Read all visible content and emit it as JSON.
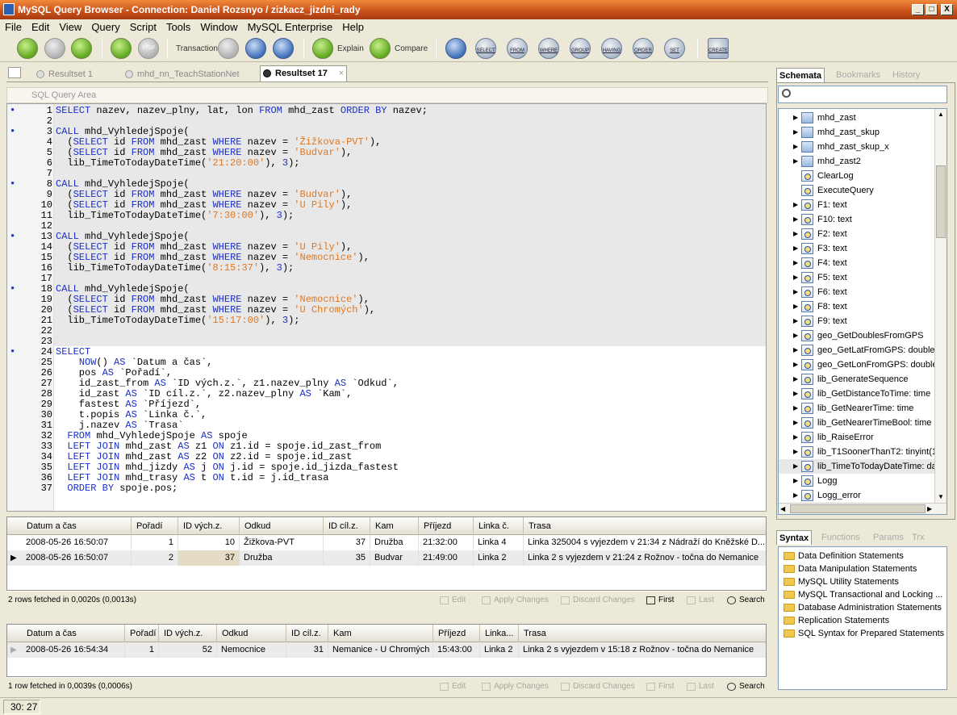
{
  "window": {
    "title": "MySQL Query Browser - Connection: Daniel Rozsnyo / zizkacz_jizdni_rady",
    "buttons": {
      "minimize": "_",
      "maximize": "□",
      "close": "X"
    }
  },
  "menu": [
    "File",
    "Edit",
    "View",
    "Query",
    "Script",
    "Tools",
    "Window",
    "MySQL Enterprise",
    "Help"
  ],
  "toolbar": {
    "transaction_label": "Transaction",
    "explain_label": "Explain",
    "compare_label": "Compare",
    "stop_label": "STOP",
    "clause_buttons": [
      "SELECT",
      "FROM",
      "WHERE",
      "GROUP",
      "HAVING",
      "ORDER",
      "SET"
    ],
    "create_label": "CREATE"
  },
  "tabs": [
    {
      "label": "Resultset 1",
      "active": false
    },
    {
      "label": "mhd_nn_TeachStationNet",
      "active": false
    },
    {
      "label": "Resultset 17",
      "active": true
    }
  ],
  "tab_close": "×",
  "sql_area_label": "SQL Query Area",
  "editor": {
    "lines": [
      {
        "n": "1",
        "b": true,
        "t": "SELECT nazev, nazev_plny, lat, lon FROM mhd_zast ORDER BY nazev;"
      },
      {
        "n": "2",
        "b": false,
        "t": ""
      },
      {
        "n": "3",
        "b": true,
        "t": "CALL mhd_VyhledejSpoje("
      },
      {
        "n": "4",
        "b": false,
        "t": "  (SELECT id FROM mhd_zast WHERE nazev = 'Žižkova-PVT'),"
      },
      {
        "n": "5",
        "b": false,
        "t": "  (SELECT id FROM mhd_zast WHERE nazev = 'Budvar'),"
      },
      {
        "n": "6",
        "b": false,
        "t": "  lib_TimeToTodayDateTime('21:20:00'), 3);"
      },
      {
        "n": "7",
        "b": false,
        "t": ""
      },
      {
        "n": "8",
        "b": true,
        "t": "CALL mhd_VyhledejSpoje("
      },
      {
        "n": "9",
        "b": false,
        "t": "  (SELECT id FROM mhd_zast WHERE nazev = 'Budvar'),"
      },
      {
        "n": "10",
        "b": false,
        "t": "  (SELECT id FROM mhd_zast WHERE nazev = 'U Pily'),"
      },
      {
        "n": "11",
        "b": false,
        "t": "  lib_TimeToTodayDateTime('7:30:00'), 3);"
      },
      {
        "n": "12",
        "b": false,
        "t": ""
      },
      {
        "n": "13",
        "b": true,
        "t": "CALL mhd_VyhledejSpoje("
      },
      {
        "n": "14",
        "b": false,
        "t": "  (SELECT id FROM mhd_zast WHERE nazev = 'U Pily'),"
      },
      {
        "n": "15",
        "b": false,
        "t": "  (SELECT id FROM mhd_zast WHERE nazev = 'Nemocnice'),"
      },
      {
        "n": "16",
        "b": false,
        "t": "  lib_TimeToTodayDateTime('8:15:37'), 3);"
      },
      {
        "n": "17",
        "b": false,
        "t": ""
      },
      {
        "n": "18",
        "b": true,
        "t": "CALL mhd_VyhledejSpoje("
      },
      {
        "n": "19",
        "b": false,
        "t": "  (SELECT id FROM mhd_zast WHERE nazev = 'Nemocnice'),"
      },
      {
        "n": "20",
        "b": false,
        "t": "  (SELECT id FROM mhd_zast WHERE nazev = 'U Chromých'),"
      },
      {
        "n": "21",
        "b": false,
        "t": "  lib_TimeToTodayDateTime('15:17:00'), 3);"
      },
      {
        "n": "22",
        "b": false,
        "t": ""
      },
      {
        "n": "23",
        "b": false,
        "t": ""
      },
      {
        "n": "24",
        "b": true,
        "t": "SELECT"
      },
      {
        "n": "25",
        "b": false,
        "t": "    NOW() AS `Datum a čas`,"
      },
      {
        "n": "26",
        "b": false,
        "t": "    pos AS `Pořadí`,"
      },
      {
        "n": "27",
        "b": false,
        "t": "    id_zast_from AS `ID vých.z.`, z1.nazev_plny AS `Odkud`,"
      },
      {
        "n": "28",
        "b": false,
        "t": "    id_zast AS `ID cíl.z.`, z2.nazev_plny AS `Kam`,"
      },
      {
        "n": "29",
        "b": false,
        "t": "    fastest AS `Příjezd`,"
      },
      {
        "n": "30",
        "b": false,
        "t": "    t.popis AS `Linka č.`,"
      },
      {
        "n": "31",
        "b": false,
        "t": "    j.nazev AS `Trasa`"
      },
      {
        "n": "32",
        "b": false,
        "t": "  FROM mhd_VyhledejSpoje AS spoje"
      },
      {
        "n": "33",
        "b": false,
        "t": "  LEFT JOIN mhd_zast AS z1 ON z1.id = spoje.id_zast_from"
      },
      {
        "n": "34",
        "b": false,
        "t": "  LEFT JOIN mhd_zast AS z2 ON z2.id = spoje.id_zast"
      },
      {
        "n": "35",
        "b": false,
        "t": "  LEFT JOIN mhd_jizdy AS j ON j.id = spoje.id_jizda_fastest"
      },
      {
        "n": "36",
        "b": false,
        "t": "  LEFT JOIN mhd_trasy AS t ON t.id = j.id_trasa"
      },
      {
        "n": "37",
        "b": false,
        "t": "  ORDER BY spoje.pos;"
      }
    ]
  },
  "result1": {
    "columns": [
      "Datum a čas",
      "Pořadí",
      "ID vých.z.",
      "Odkud",
      "ID cíl.z.",
      "Kam",
      "Příjezd",
      "Linka č.",
      "Trasa"
    ],
    "rows": [
      [
        "2008-05-26 16:50:07",
        "1",
        "10",
        "Žižkova-PVT",
        "37",
        "Družba",
        "21:32:00",
        "Linka 4",
        "Linka 325004 s vyjezdem v 21:34 z Nádraží do Kněžské D..."
      ],
      [
        "2008-05-26 16:50:07",
        "2",
        "37",
        "Družba",
        "35",
        "Budvar",
        "21:49:00",
        "Linka 2",
        "Linka 2 s vyjezdem v 21:24 z Rožnov - točna do Nemanice"
      ]
    ],
    "status": "2 rows fetched in 0,0020s (0,0013s)"
  },
  "result2": {
    "columns": [
      "Datum a čas",
      "Pořadí",
      "ID vých.z.",
      "Odkud",
      "ID cíl.z.",
      "Kam",
      "Příjezd",
      "Linka...",
      "Trasa"
    ],
    "rows": [
      [
        "2008-05-26 16:54:34",
        "1",
        "52",
        "Nemocnice",
        "31",
        "Nemanice - U Chromých",
        "15:43:00",
        "Linka 2",
        "Linka 2 s vyjezdem v 15:18 z Rožnov - točna do Nemanice"
      ]
    ],
    "status": "1 row fetched in 0,0039s (0,0006s)"
  },
  "result_actions": [
    "Edit",
    "Apply Changes",
    "Discard Changes",
    "First",
    "Last",
    "Search"
  ],
  "right_tabs": [
    "Schemata",
    "Bookmarks",
    "History"
  ],
  "schema_items": [
    {
      "label": "mhd_zast",
      "type": "table"
    },
    {
      "label": "mhd_zast_skup",
      "type": "table"
    },
    {
      "label": "mhd_zast_skup_x",
      "type": "table"
    },
    {
      "label": "mhd_zast2",
      "type": "table"
    },
    {
      "label": "ClearLog",
      "type": "proc"
    },
    {
      "label": "ExecuteQuery",
      "type": "proc"
    },
    {
      "label": "F1: text",
      "type": "fn"
    },
    {
      "label": "F10: text",
      "type": "fn"
    },
    {
      "label": "F2: text",
      "type": "fn"
    },
    {
      "label": "F3: text",
      "type": "fn"
    },
    {
      "label": "F4: text",
      "type": "fn"
    },
    {
      "label": "F5: text",
      "type": "fn"
    },
    {
      "label": "F6: text",
      "type": "fn"
    },
    {
      "label": "F8: text",
      "type": "fn"
    },
    {
      "label": "F9: text",
      "type": "fn"
    },
    {
      "label": "geo_GetDoublesFromGPS",
      "type": "fn"
    },
    {
      "label": "geo_GetLatFromGPS: double",
      "type": "fn"
    },
    {
      "label": "geo_GetLonFromGPS: double",
      "type": "fn"
    },
    {
      "label": "lib_GenerateSequence",
      "type": "fn"
    },
    {
      "label": "lib_GetDistanceToTime: time",
      "type": "fn"
    },
    {
      "label": "lib_GetNearerTime: time",
      "type": "fn"
    },
    {
      "label": "lib_GetNearerTimeBool: time",
      "type": "fn"
    },
    {
      "label": "lib_RaiseError",
      "type": "fn"
    },
    {
      "label": "lib_T1SoonerThanT2: tinyint(1)",
      "type": "fn"
    },
    {
      "label": "lib_TimeToTodayDateTime: da",
      "type": "fn"
    },
    {
      "label": "Logg",
      "type": "fn"
    },
    {
      "label": "Logg_error",
      "type": "fn"
    }
  ],
  "syntax_tabs": [
    "Syntax",
    "Functions",
    "Params",
    "Trx"
  ],
  "syntax_items": [
    "Data Definition Statements",
    "Data Manipulation Statements",
    "MySQL Utility Statements",
    "MySQL Transactional and Locking ...",
    "Database Administration Statements",
    "Replication Statements",
    "SQL Syntax for Prepared Statements"
  ],
  "cursor_pos": "30: 27"
}
